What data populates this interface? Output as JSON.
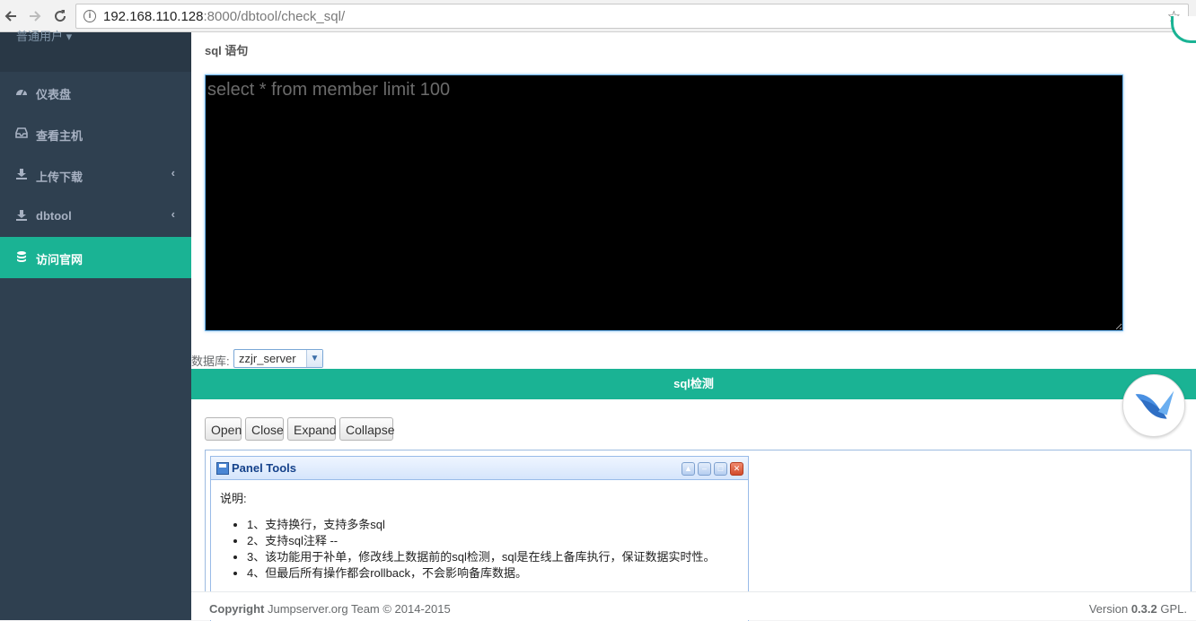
{
  "browser": {
    "url_host": "192.168.110.128",
    "url_rest": ":8000/dbtool/check_sql/"
  },
  "sidebar": {
    "user": "普通用户",
    "items": [
      {
        "label": "仪表盘",
        "icon": "dashboard-icon"
      },
      {
        "label": "查看主机",
        "icon": "inbox-icon"
      },
      {
        "label": "上传下载",
        "icon": "download-icon",
        "arrow": "‹"
      },
      {
        "label": "dbtool",
        "icon": "download-icon",
        "arrow": "‹"
      },
      {
        "label": "访问官网",
        "icon": "database-icon"
      }
    ]
  },
  "main": {
    "sql_label": "sql 语句",
    "sql_value": "select * from member limit 100",
    "db_label": "数据库:",
    "db_selected": "zzjr_server",
    "check_button": "sql检测",
    "tree_buttons": [
      "Open",
      "Close",
      "Expand",
      "Collapse"
    ],
    "panel": {
      "title": "Panel Tools",
      "heading": "说明:",
      "items": [
        "1、支持换行，支持多条sql",
        "2、支持sql注释 --",
        "3、该功能用于补单，修改线上数据前的sql检测，sql是在线上备库执行，保证数据实时性。",
        "4、但最后所有操作都会rollback，不会影响备库数据。"
      ]
    }
  },
  "footer": {
    "copyright_label": "Copyright",
    "copyright_text": " Jumpserver.org Team © 2014-2015",
    "version_prefix": "Version ",
    "version_number": "0.3.2",
    "version_suffix": " GPL."
  },
  "colors": {
    "accent": "#1ab394",
    "sidebar_bg": "#2f4050"
  }
}
